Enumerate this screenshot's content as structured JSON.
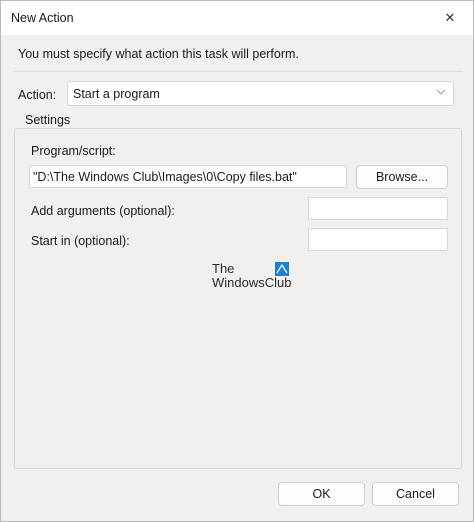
{
  "window": {
    "title": "New Action",
    "close_glyph": "✕"
  },
  "instruction": "You must specify what action this task will perform.",
  "action": {
    "label": "Action:",
    "value": "Start a program",
    "chevron_icon": "chevron-down-icon"
  },
  "settings": {
    "legend": "Settings",
    "program_label": "Program/script:",
    "program_value": "\"D:\\The Windows Club\\Images\\0\\Copy files.bat\"",
    "browse_label": "Browse...",
    "arguments_label": "Add arguments (optional):",
    "arguments_value": "",
    "start_in_label": "Start in (optional):",
    "start_in_value": ""
  },
  "watermark": {
    "line1": "The",
    "line2": "WindowsClub",
    "accent": "#1e7fd1"
  },
  "buttons": {
    "ok": "OK",
    "cancel": "Cancel"
  }
}
